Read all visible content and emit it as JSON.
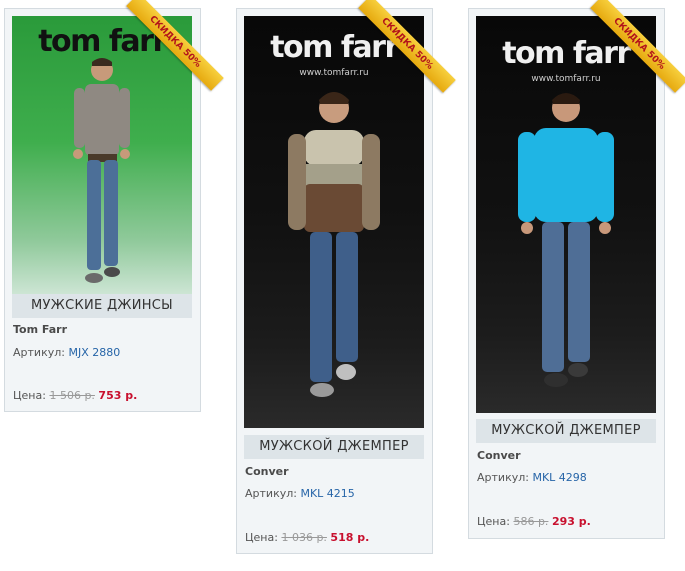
{
  "products": [
    {
      "logo": "tom farr",
      "logo_sub": "",
      "badge": "СКИДКА 50%",
      "name": "МУЖСКИЕ ДЖИНСЫ",
      "brand": "Tom Farr",
      "sku_label": "Артикул:",
      "sku": "MJX 2880",
      "price_label": "Цена:",
      "old_price": "1 506 р.",
      "new_price": "753 р."
    },
    {
      "logo": "tom farr",
      "logo_sub": "www.tomfarr.ru",
      "badge": "СКИДКА 50%",
      "name": "МУЖСКОЙ ДЖЕМПЕР",
      "brand": "Conver",
      "sku_label": "Артикул:",
      "sku": "MKL 4215",
      "price_label": "Цена:",
      "old_price": "1 036 р.",
      "new_price": "518 р."
    },
    {
      "logo": "tom farr",
      "logo_sub": "www.tomfarr.ru",
      "badge": "СКИДКА 50%",
      "name": "МУЖСКОЙ ДЖЕМПЕР",
      "brand": "Conver",
      "sku_label": "Артикул:",
      "sku": "MKL 4298",
      "price_label": "Цена:",
      "old_price": "586 р.",
      "new_price": "293 р."
    }
  ],
  "colors": {
    "card_bg": "#f2f5f7",
    "name_bar_bg": "#dde4e8",
    "sku_link": "#2765a8",
    "new_price": "#c8102e",
    "badge": "#e6a90f"
  }
}
